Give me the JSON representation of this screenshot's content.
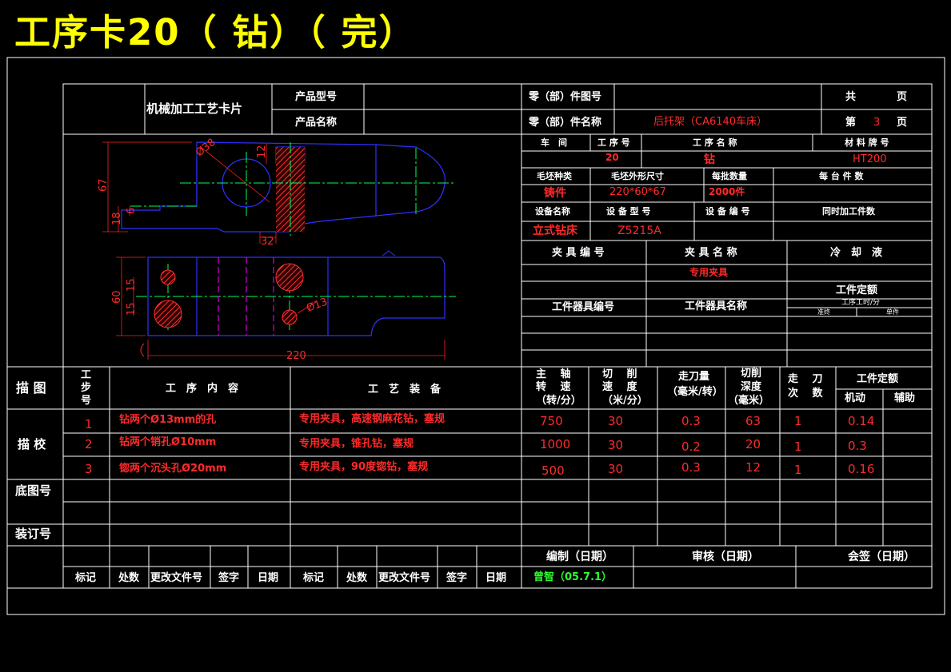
{
  "title": "工序卡20（ 钻）（ 完）",
  "colors": {
    "grid": "#ffffff",
    "red": "#ff2a2a",
    "yellow": "#ffff00",
    "green": "#2cff2c",
    "blue": "#3030ff",
    "cyan": "#00ffff",
    "magenta": "#ff00ff",
    "hatch": "#ff3030"
  },
  "header": {
    "card_name": "机械加工工艺卡片",
    "product_model_label": "产品型号",
    "product_name_label": "产品名称",
    "part_no_label": "零（部）件图号",
    "part_name_label": "零（部）件名称",
    "part_name_value": "后托架（CA6140车床）",
    "total_label": "共",
    "page_unit_1": "页",
    "page_label": "第",
    "page_value": "3",
    "page_unit_2": "页"
  },
  "info": {
    "workshop_label": "车　间",
    "op_no_label": "工 序 号",
    "op_name_label": "工 序 名 称",
    "material_label": "材 料 牌 号",
    "op_no": "20",
    "op_name": "钻",
    "material": "HT200",
    "blank_type_label": "毛坯种类",
    "blank_size_label": "毛坯外形尺寸",
    "batch_label": "每批数量",
    "per_unit_label": "每 台 件 数",
    "blank_type": "铸件",
    "blank_size": "220*60*67",
    "batch": "2000件",
    "equip_name_label": "设备名称",
    "equip_model_label": "设 备 型 号",
    "equip_no_label": "设 备 编 号",
    "simul_label": "同时加工件数",
    "equip_name": "立式钻床",
    "equip_model": "Z5215A",
    "fixture_no_label": "夹 具 编 号",
    "fixture_name_label": "夹 具 名 称",
    "coolant_label": "冷　却　液",
    "fixture_name": "专用夹具",
    "quota_label": "工件定额",
    "tool_no_label": "工件器具编号",
    "tool_name_label": "工件器具名称",
    "unit_time_label": "工序工时/分",
    "prep_label": "准终",
    "single_label": "单件"
  },
  "drawing": {
    "dims": [
      "67",
      "Ø38",
      "12",
      "18",
      "6",
      "32",
      "60",
      "15",
      "15",
      "Ø13",
      "220"
    ]
  },
  "steps": {
    "side_labels": [
      "描 图",
      "描 校",
      "底图号",
      "装订号"
    ],
    "col_step": "工\n步\n号",
    "col_content": "工　序　内　容",
    "col_equip": "工　艺　装　备",
    "col_speed": [
      "主　 轴",
      "转　 速",
      "（转/分）"
    ],
    "col_cut": [
      "切　 削",
      "速　 度",
      "（米/分）"
    ],
    "col_feed": [
      "走刀量",
      "（毫米/转）"
    ],
    "col_depth": [
      "切削",
      "深度",
      "（毫米）"
    ],
    "col_passes": [
      "走　 刀",
      "次　 数"
    ],
    "col_quota": "工件定额",
    "col_machine": "机动",
    "col_aux": "辅助",
    "rows": [
      {
        "no": "1",
        "content": "钻两个Ø13mm的孔",
        "equip": "专用夹具，高速钢麻花钻，塞规",
        "speed": "750",
        "cut": "30",
        "feed": "0.3",
        "depth": "63",
        "passes": "1",
        "machine": "0.14"
      },
      {
        "no": "2",
        "content": "钻两个销孔Ø10mm",
        "equip": "专用夹具，锥孔钻，塞规",
        "speed": "1000",
        "cut": "30",
        "feed": "0.2",
        "depth": "20",
        "passes": "1",
        "machine": "0.3"
      },
      {
        "no": "3",
        "content": "锪两个沉头孔Ø20mm",
        "equip": "专用夹具，90度锪钻，塞规",
        "speed": "500",
        "cut": "30",
        "feed": "0.3",
        "depth": "12",
        "passes": "1",
        "machine": "0.16"
      }
    ]
  },
  "footer": {
    "compiled_label": "编制（日期）",
    "review_label": "审核（日期）",
    "sign_label": "会签（日期）",
    "compiled_value": "曾智（05.7.1）",
    "labels": [
      "标记",
      "处数",
      "更改文件号",
      "签字",
      "日期",
      "标记",
      "处数",
      "更改文件号",
      "签字",
      "日期"
    ]
  }
}
